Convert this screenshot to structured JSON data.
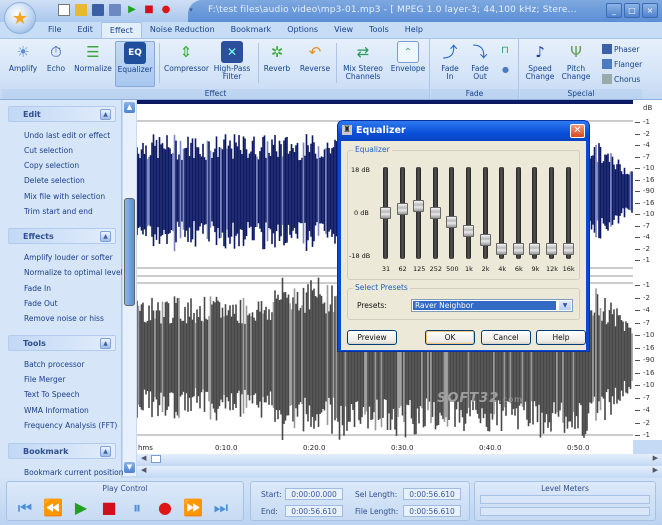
{
  "window": {
    "title": "F:\\test files\\audio video\\mp3-01.mp3 - [ MPEG 1.0 layer-3; 44,100 kHz; Stere...",
    "controls": [
      "minimize",
      "maximize",
      "close"
    ]
  },
  "quick_access": [
    "new-file-icon",
    "open-folder-icon",
    "save-icon",
    "save-as-icon",
    "play-icon",
    "stop-icon",
    "record-icon",
    "customize-icon"
  ],
  "menu": {
    "items": [
      "File",
      "Edit",
      "Effect",
      "Noise Reduction",
      "Bookmark",
      "Options",
      "View",
      "Tools",
      "Help"
    ],
    "active": "Effect"
  },
  "ribbon": {
    "groups": [
      {
        "label": "Effect",
        "buttons": [
          {
            "label": "Amplify",
            "icon": "amplify-icon"
          },
          {
            "label": "Echo",
            "icon": "echo-icon"
          },
          {
            "label": "Normalize",
            "icon": "normalize-icon"
          },
          {
            "label": "Equalizer",
            "icon": "equalizer-icon",
            "selected": true
          },
          {
            "label": "Compressor",
            "icon": "compressor-icon"
          },
          {
            "label": "High-Pass Filter",
            "icon": "high-pass-filter-icon"
          },
          {
            "label": "Reverb",
            "icon": "reverb-icon"
          },
          {
            "label": "Reverse",
            "icon": "reverse-icon"
          },
          {
            "label": "Mix Stereo Channels",
            "icon": "mix-stereo-icon"
          },
          {
            "label": "Envelope",
            "icon": "envelope-icon"
          }
        ]
      },
      {
        "label": "Fade",
        "buttons": [
          {
            "label": "Fade In",
            "icon": "fade-in-icon"
          },
          {
            "label": "Fade Out",
            "icon": "fade-out-icon"
          }
        ]
      },
      {
        "label": "Special",
        "buttons": [
          {
            "label": "Speed Change",
            "icon": "speed-change-icon"
          },
          {
            "label": "Pitch Change",
            "icon": "pitch-change-icon"
          },
          {
            "label": "Phaser",
            "icon": "phaser-icon"
          },
          {
            "label": "Flanger",
            "icon": "flanger-icon"
          },
          {
            "label": "Chorus",
            "icon": "chorus-icon"
          }
        ]
      }
    ]
  },
  "sidebar": {
    "sections": [
      {
        "title": "Edit",
        "items": [
          "Undo last edit or effect",
          "Cut selection",
          "Copy selection",
          "Delete selection",
          "Mix file with selection",
          "Trim start and end"
        ]
      },
      {
        "title": "Effects",
        "items": [
          "Amplify louder or softer",
          "Normalize to optimal level",
          "Fade In",
          "Fade Out",
          "Remove noise or hiss"
        ]
      },
      {
        "title": "Tools",
        "items": [
          "Batch processor",
          "File Merger",
          "Text To Speech",
          "WMA Information",
          "Frequency Analysis (FFT)"
        ]
      },
      {
        "title": "Bookmark",
        "items": [
          "Bookmark current position"
        ]
      }
    ]
  },
  "waveform": {
    "db_scale_label": "dB",
    "db_ticks": [
      "-1",
      "-2",
      "-4",
      "-7",
      "-10",
      "-16",
      "-90",
      "-16",
      "-10",
      "-7",
      "-4",
      "-2",
      "-1"
    ],
    "channel_colors": {
      "left": "#0d1a63",
      "right": "#474747"
    },
    "time_unit": "hms",
    "time_labels": [
      "0:10.0",
      "0:20.0",
      "0:30.0",
      "0:40.0",
      "0:50.0"
    ]
  },
  "equalizer_dialog": {
    "title": "Equalizer",
    "group_label": "Equalizer",
    "db_labels": {
      "max": "18 dB",
      "mid": "0 dB",
      "min": "-18 dB"
    },
    "db_range": [
      -18,
      18
    ],
    "bands": [
      {
        "freq": "31",
        "gain_db": 0
      },
      {
        "freq": "62",
        "gain_db": 2
      },
      {
        "freq": "125",
        "gain_db": 3
      },
      {
        "freq": "252",
        "gain_db": 0
      },
      {
        "freq": "500",
        "gain_db": -4
      },
      {
        "freq": "1k",
        "gain_db": -8
      },
      {
        "freq": "2k",
        "gain_db": -12
      },
      {
        "freq": "4k",
        "gain_db": -16
      },
      {
        "freq": "6k",
        "gain_db": -16
      },
      {
        "freq": "9k",
        "gain_db": -16
      },
      {
        "freq": "12k",
        "gain_db": -16
      },
      {
        "freq": "16k",
        "gain_db": -16
      }
    ],
    "presets_group": "Select Presets",
    "presets_label": "Presets:",
    "preset_value": "Raver Neighbor",
    "buttons": {
      "preview": "Preview",
      "ok": "OK",
      "cancel": "Cancel",
      "help": "Help"
    }
  },
  "play_control": {
    "title": "Play Control",
    "buttons": [
      "go-to-start",
      "rewind",
      "play",
      "stop",
      "pause",
      "record",
      "fast-forward",
      "go-to-end"
    ]
  },
  "time_fields": {
    "start_label": "Start:",
    "start": "0:00:00.000",
    "end_label": "End:",
    "end": "0:00:56.610",
    "sel_length_label": "Sel Length:",
    "sel_length": "0:00:56.610",
    "file_length_label": "File Length:",
    "file_length": "0:00:56.610"
  },
  "level_meters": {
    "title": "Level Meters"
  },
  "watermark": {
    "main": "SOFT32",
    "suffix": ".com"
  }
}
